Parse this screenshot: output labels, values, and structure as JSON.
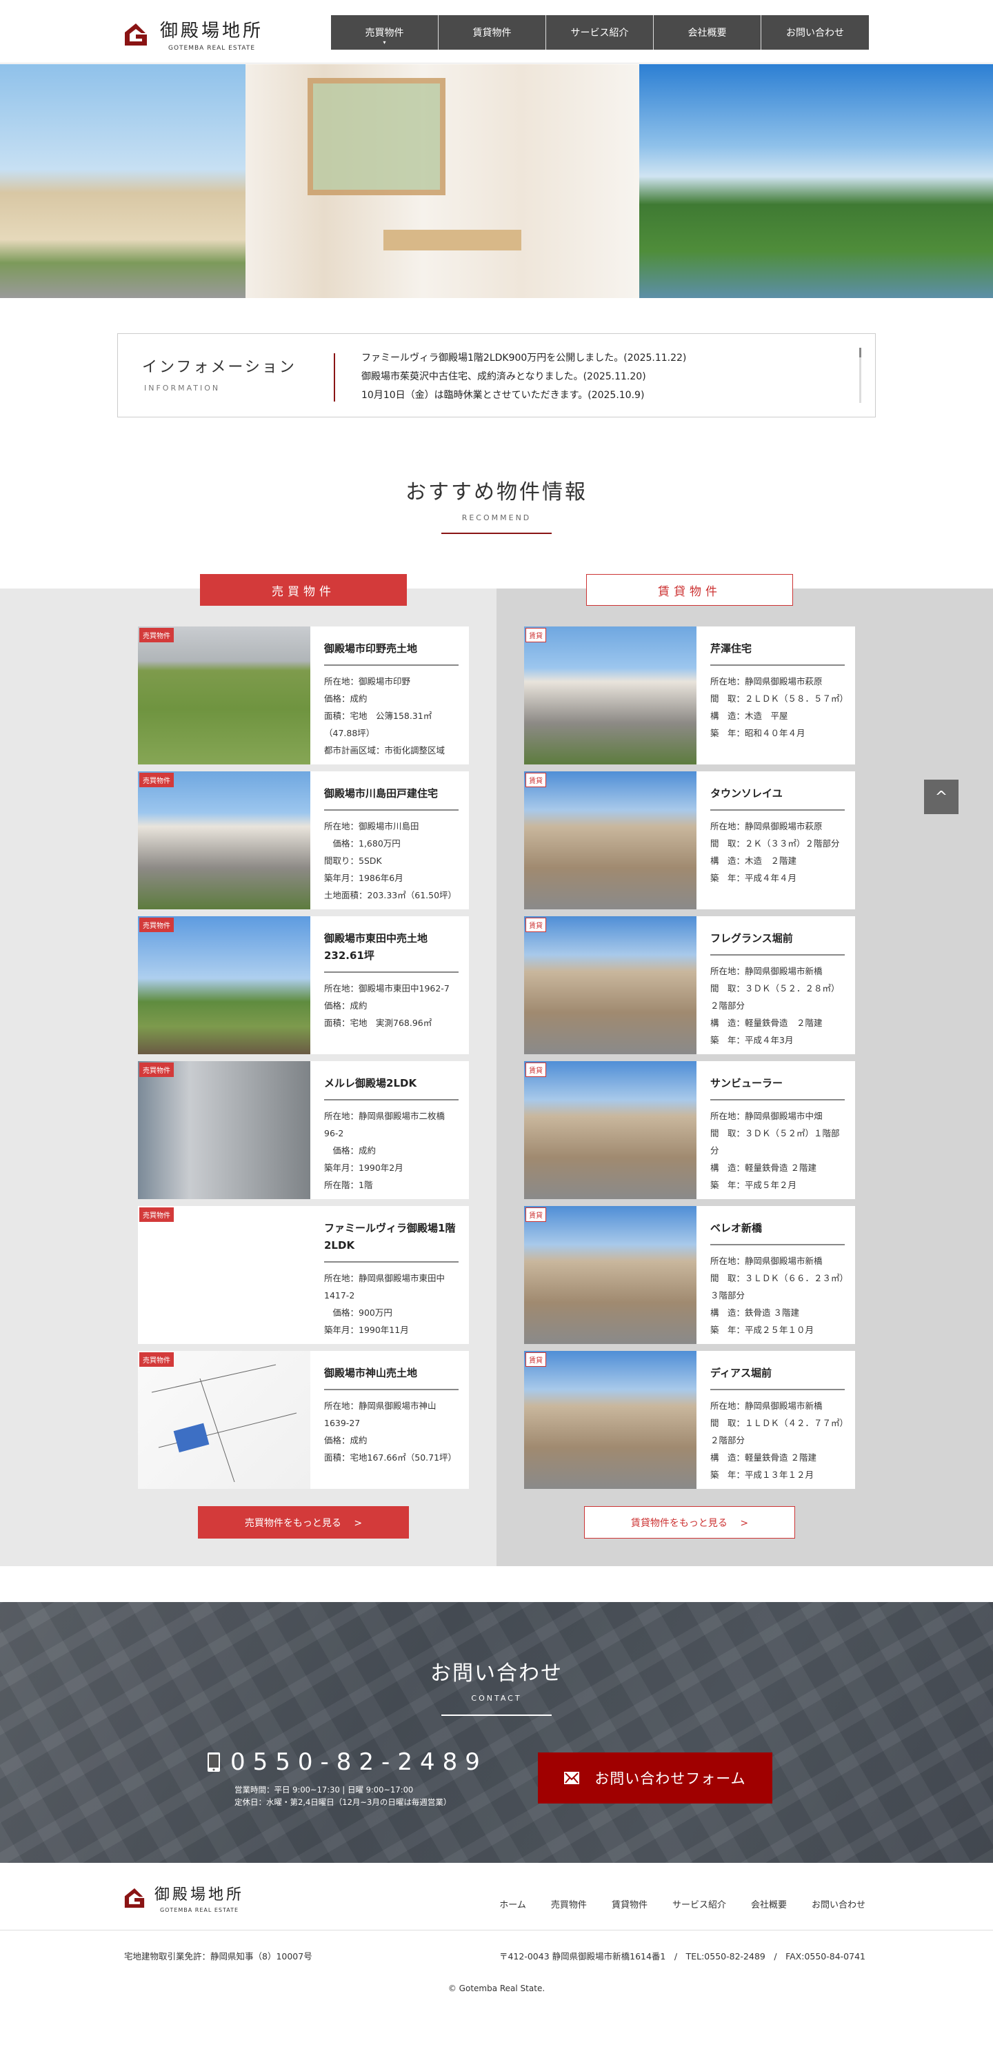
{
  "header": {
    "logo_jp": "御殿場地所",
    "logo_en": "GOTEMBA REAL ESTATE",
    "nav": [
      "売買物件",
      "賃貸物件",
      "サービス紹介",
      "会社概要",
      "お問い合わせ"
    ],
    "nav_dot": "▾"
  },
  "info": {
    "title": "インフォメーション",
    "subtitle": "INFORMATION",
    "items": [
      "ファミールヴィラ御殿場1階2LDK900万円を公開しました。(2025.11.22)",
      "御殿場市茱萸沢中古住宅、成約済みとなりました。(2025.11.20)",
      "10月10日（金）は臨時休業とさせていただきます。(2025.10.9)"
    ]
  },
  "recommend": {
    "title": "おすすめ物件情報",
    "subtitle": "RECOMMEND",
    "tab_sale": "売買物件",
    "tab_rent": "賃貸物件",
    "sale_badge": "売買物件",
    "rent_badge": "賃貸",
    "more_sale": "売買物件をもっと見る　 >",
    "more_rent": "賃貸物件をもっと見る　 >",
    "sale": [
      {
        "title": "御殿場市印野売土地",
        "lines": [
          "所在地：御殿場市印野",
          "価格：成約",
          "面積：宅地　公簿158.31㎡（47.88坪）",
          "都市計画区域：市街化調整区域"
        ],
        "img": "grass"
      },
      {
        "title": "御殿場市川島田戸建住宅",
        "lines": [
          "所在地：御殿場市川島田",
          "　価格：1,680万円",
          "間取り：5SDK",
          "築年月：1986年6月",
          "土地面積：203.33㎡（61.50坪）"
        ],
        "img": "house"
      },
      {
        "title": "御殿場市東田中売土地232.61坪",
        "lines": [
          "所在地：御殿場市東田中1962-7",
          "価格：成約",
          "面積：宅地　実測768.96㎡"
        ],
        "img": "field"
      },
      {
        "title": "メルレ御殿場2LDK",
        "lines": [
          "所在地：静岡県御殿場市二枚橋96-2",
          "　価格：成約",
          "築年月：1990年2月",
          "所在階：1階"
        ],
        "img": "building"
      },
      {
        "title": "ファミールヴィラ御殿場1階2LDK",
        "lines": [
          "所在地：静岡県御殿場市東田中1417-2",
          "　価格：900万円",
          "築年月：1990年11月"
        ],
        "img": "blank"
      },
      {
        "title": "御殿場市神山売土地",
        "lines": [
          "所在地：静岡県御殿場市神山1639-27",
          "価格：成約",
          "面積：宅地167.66㎡（50.71坪）"
        ],
        "img": "map"
      }
    ],
    "rent": [
      {
        "title": "芹澤住宅",
        "lines": [
          "所在地：静岡県御殿場市萩原",
          "間　取：２ＬＤＫ（５８．５７㎡）",
          "構　造：木造　平屋",
          "築　年：昭和４０年４月"
        ],
        "img": "house"
      },
      {
        "title": "タウンソレイユ",
        "lines": [
          "所在地：静岡県御殿場市萩原",
          "間　取：２Ｋ（３３㎡）２階部分",
          "構　造：木造　２階建",
          "築　年：平成４年４月"
        ],
        "img": "apt"
      },
      {
        "title": "フレグランス堀前",
        "lines": [
          "所在地：静岡県御殿場市新橋",
          "間　取：３ＤＫ（５２．２８㎡）２階部分",
          "構　造：軽量鉄骨造　２階建",
          "築　年：平成４年3月"
        ],
        "img": "apt"
      },
      {
        "title": "サンビューラー",
        "lines": [
          "所在地：静岡県御殿場市中畑",
          "間　取：３ＤＫ（５２㎡）１階部分",
          "構　造：軽量鉄骨造 ２階建",
          "築　年：平成５年２月"
        ],
        "img": "apt"
      },
      {
        "title": "ベレオ新橋",
        "lines": [
          "所在地：静岡県御殿場市新橋",
          "間　取：３ＬＤＫ（６６．２３㎡）３階部分",
          "構　造：鉄骨造 ３階建",
          "築　年：平成２５年１０月"
        ],
        "img": "apt"
      },
      {
        "title": "ディアス堀前",
        "lines": [
          "所在地：静岡県御殿場市新橋",
          "間　取：１ＬＤＫ（４２．７７㎡）２階部分",
          "構　造：軽量鉄骨造 ２階建",
          "築　年：平成１３年１２月"
        ],
        "img": "apt"
      }
    ]
  },
  "back_to_top": "^",
  "contact": {
    "title": "お問い合わせ",
    "subtitle": "CONTACT",
    "phone": "0550-82-2489",
    "hours": "営業時間：平日 9:00~17:30 | 日曜 9:00~17:00",
    "holiday": "定休日：水曜・第2,4日曜日（12月~3月の日曜は毎週営業）",
    "form_button": "お問い合わせフォーム"
  },
  "footer": {
    "logo_jp": "御殿場地所",
    "logo_en": "GOTEMBA REAL ESTATE",
    "nav": [
      "ホーム",
      "売買物件",
      "賃貸物件",
      "サービス紹介",
      "会社概要",
      "お問い合わせ"
    ],
    "license": "宅地建物取引業免許：静岡県知事（8）10007号",
    "address": "〒412-0043 静岡県御殿場市新橋1614番1　/　TEL:0550-82-2489　/　FAX:0550-84-0741",
    "copyright": "© Gotemba Real State."
  },
  "colors": {
    "accent": "#d33a3a",
    "dark_red": "#a00000",
    "nav_bg": "#4a4a4a"
  }
}
